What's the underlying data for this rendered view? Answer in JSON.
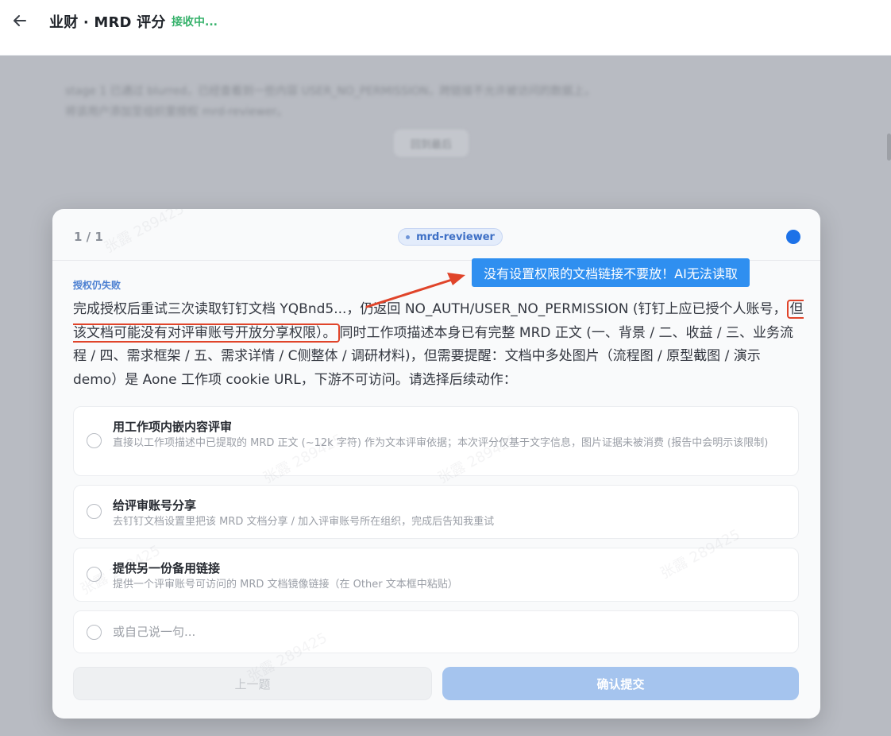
{
  "header": {
    "title": "业财 · MRD 评分",
    "status": "接收中..."
  },
  "background": {
    "text": "stage 1 已通过 blurred，已经查看到一些内容 USER_NO_PERMISSION，跨链接不允许被访问的数据上，将该用户添加至组织里授权 mrd-reviewer。",
    "pill_label": "回到最后"
  },
  "modal": {
    "counter": "1 / 1",
    "agent": "mrd-reviewer",
    "section_label": "授权仍失败",
    "question": {
      "part1": "完成授权后重试三次读取钉钉文档 YQBnd5...，仍返回 NO_AUTH/USER_NO_PERMISSION (钉钉上应已授个人账号，",
      "highlight": "但该文档可能没有对评审账号开放分享权限）。",
      "part2": "同时工作项描述本身已有完整 MRD 正文 (一、背景 / 二、收益 / 三、业务流程 / 四、需求框架 / 五、需求详情 / C侧整体 / 调研材料)，但需要提醒：文档中多处图片（流程图 / 原型截图 / 演示 demo）是 Aone 工作项 cookie URL，下游不可访问。请选择后续动作："
    },
    "options": [
      {
        "title": "用工作项内嵌内容评审",
        "desc": "直接以工作项描述中已提取的 MRD 正文 (~12k 字符) 作为文本评审依据；本次评分仅基于文字信息，图片证据未被消费 (报告中会明示该限制)"
      },
      {
        "title": "给评审账号分享",
        "desc": "去钉钉文档设置里把该 MRD 文档分享 / 加入评审账号所在组织，完成后告知我重试"
      },
      {
        "title": "提供另一份备用链接",
        "desc": "提供一个评审账号可访问的 MRD 文档镜像链接（在 Other 文本框中粘贴）"
      }
    ],
    "other_placeholder": "或自己说一句...",
    "prev_label": "上一题",
    "submit_label": "确认提交",
    "watermark": "张露 289425"
  },
  "annotation": {
    "callout": "没有设置权限的文档链接不要放！AI无法读取",
    "arrow_color": "#e0442a",
    "callout_color": "#2f8ff0"
  },
  "icons": {
    "back": "back-arrow-icon"
  }
}
